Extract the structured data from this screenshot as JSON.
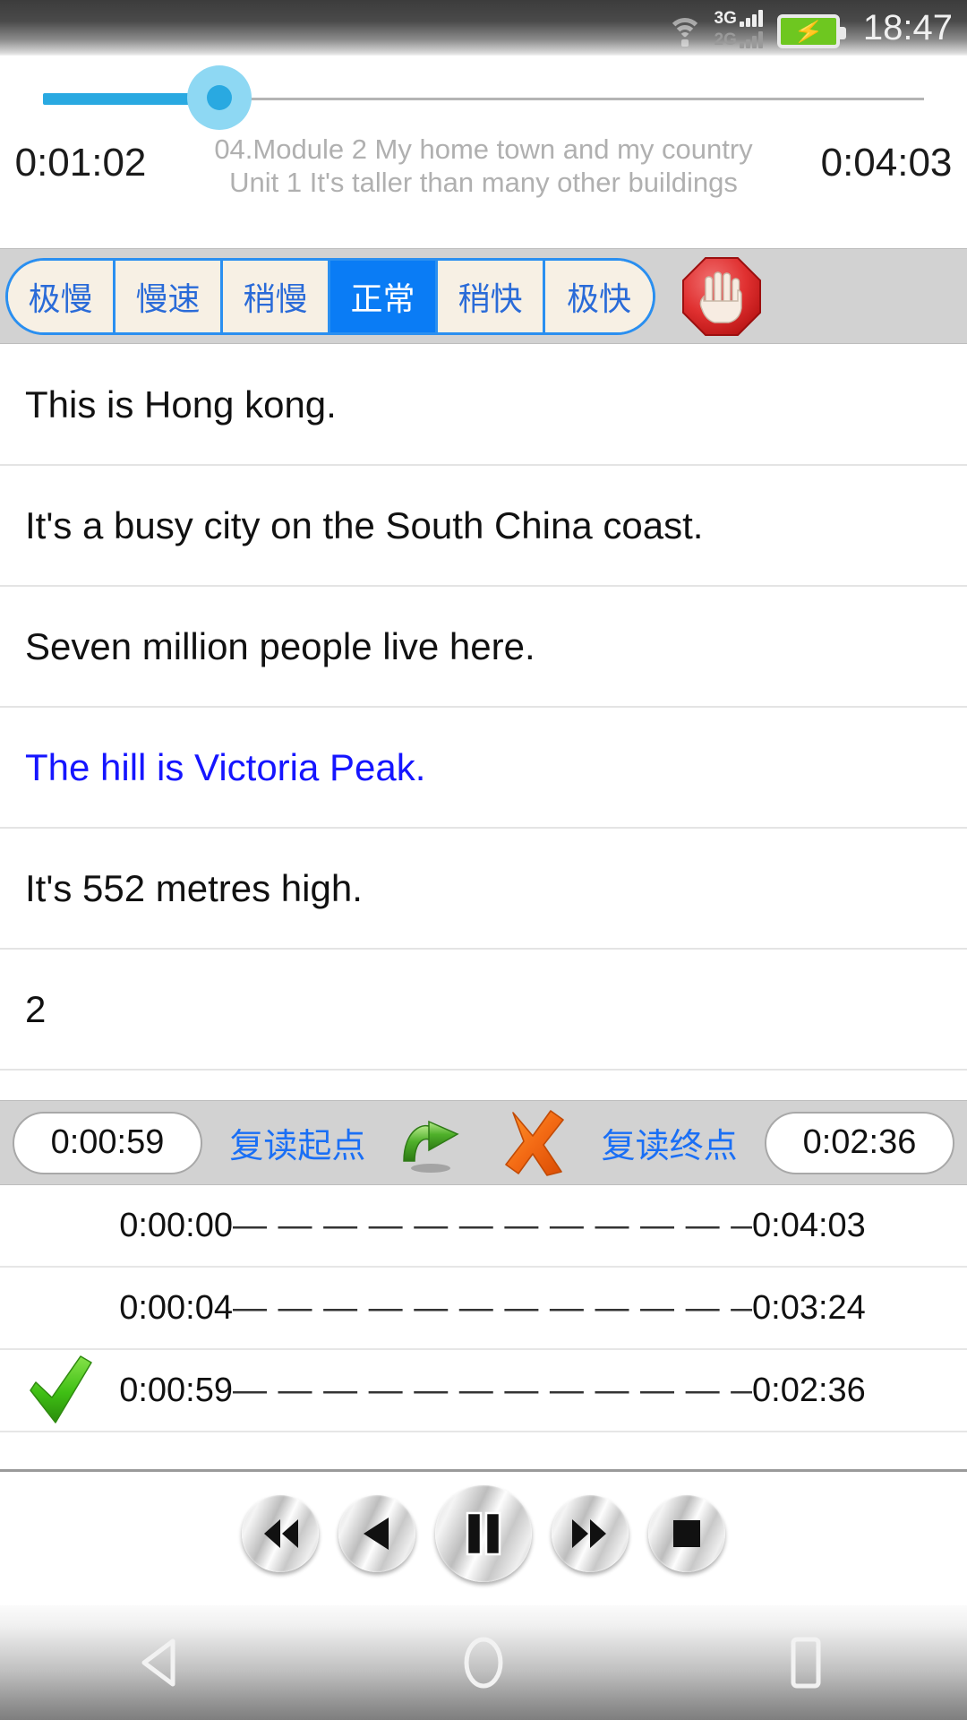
{
  "status_bar": {
    "wifi_icon": "wifi-icon",
    "signal_3g_label": "3G",
    "signal_2g_label": "2G",
    "battery_icon": "battery-charging-icon",
    "clock": "18:47"
  },
  "player": {
    "seek": {
      "icon": "seek-slider",
      "progress_percent": 20
    },
    "current_time": "0:01:02",
    "total_time": "0:04:03",
    "track_title_line1": "04.Module 2 My home town and my country",
    "track_title_line2": "Unit 1 It's taller than many other buildings"
  },
  "speed_bar": {
    "options": [
      {
        "label": "极慢",
        "selected": false
      },
      {
        "label": "慢速",
        "selected": false
      },
      {
        "label": "稍慢",
        "selected": false
      },
      {
        "label": "正常",
        "selected": true
      },
      {
        "label": "稍快",
        "selected": false
      },
      {
        "label": "极快",
        "selected": false
      }
    ],
    "stop_icon": "stop-hand-icon",
    "selected_color": "#0a7cf5",
    "text_color": "#2a6bd8",
    "button_bg": "#f7f0e4"
  },
  "sentences": [
    {
      "text": "This is Hong kong.",
      "highlighted": false
    },
    {
      "text": "It's a busy city on the South China coast.",
      "highlighted": false
    },
    {
      "text": "Seven million people live here.",
      "highlighted": false
    },
    {
      "text": "The hill is Victoria Peak.",
      "highlighted": true
    },
    {
      "text": "It's 552 metres high.",
      "highlighted": false
    },
    {
      "text": "2",
      "highlighted": false
    }
  ],
  "repeat_bar": {
    "start_time": "0:00:59",
    "start_label": "复读起点",
    "loop_icon": "green-loop-arrow-icon",
    "cancel_icon": "orange-x-icon",
    "end_label": "复读终点",
    "end_time": "0:02:36",
    "label_color": "#1a6ff5"
  },
  "bookmarks": {
    "dash_separator": "— — — — — — — — — — — —",
    "rows": [
      {
        "checked": false,
        "start": "0:00:00",
        "end": "0:04:03"
      },
      {
        "checked": false,
        "start": "0:00:04",
        "end": "0:03:24"
      },
      {
        "checked": true,
        "start": "0:00:59",
        "end": "0:02:36"
      }
    ],
    "check_icon": "green-check-icon"
  },
  "transport": {
    "buttons": [
      {
        "icon": "rewind-icon",
        "name": "rewind-button"
      },
      {
        "icon": "previous-icon",
        "name": "previous-button"
      },
      {
        "icon": "pause-icon",
        "name": "pause-button"
      },
      {
        "icon": "fast-forward-icon",
        "name": "fast-forward-button"
      },
      {
        "icon": "stop-square-icon",
        "name": "stop-button"
      }
    ]
  },
  "nav_bar": {
    "back_icon": "back-triangle-icon",
    "home_icon": "home-circle-icon",
    "recents_icon": "recents-square-icon"
  }
}
